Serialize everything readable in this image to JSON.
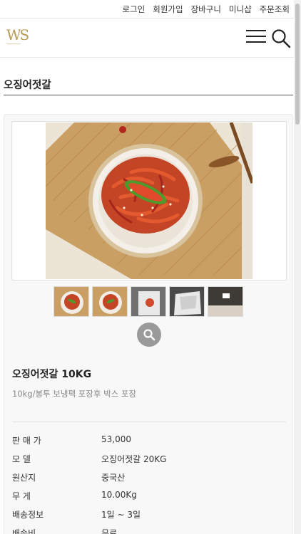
{
  "topnav": {
    "login": "로그인",
    "signup": "회원가입",
    "cart": "장바구니",
    "minishop": "미니샵",
    "order_lookup": "주문조회"
  },
  "brand": {
    "mono": "WS"
  },
  "page_title": "오징어젓갈",
  "product": {
    "name": "오징어젓갈 10KG",
    "description": "10kg/봉투 보냉팩 포장후 박스 포장",
    "info": [
      {
        "label": "판 매 가",
        "value": "53,000"
      },
      {
        "label": "모 델",
        "value": "오징어젓갈 20KG"
      },
      {
        "label": "원산지",
        "value": "중국산"
      },
      {
        "label": "무 게",
        "value": "10.00Kg"
      },
      {
        "label": "배송정보",
        "value": "1일 ~ 3일"
      },
      {
        "label": "배송비",
        "value": "무료"
      }
    ]
  },
  "colors": {
    "brand_gold": "#b79a53",
    "zoom_button": "#9a9a9a"
  }
}
